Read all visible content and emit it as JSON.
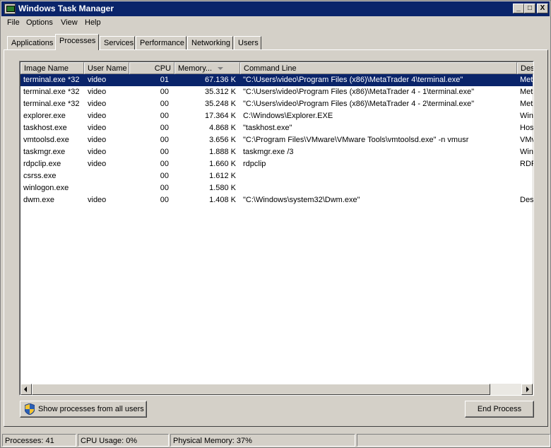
{
  "window": {
    "title": "Windows Task Manager",
    "minimize_label": "_",
    "maximize_label": "□",
    "close_label": "X"
  },
  "menu": {
    "items": [
      "File",
      "Options",
      "View",
      "Help"
    ]
  },
  "tabs": {
    "items": [
      "Applications",
      "Processes",
      "Services",
      "Performance",
      "Networking",
      "Users"
    ],
    "active": "Processes"
  },
  "table": {
    "columns": [
      "Image Name",
      "User Name",
      "CPU",
      "Memory...",
      "Command Line",
      "Des"
    ],
    "rows": [
      {
        "image": "terminal.exe *32",
        "user": "video",
        "cpu": "01",
        "memory": "67.136 K",
        "command": "\"C:\\Users\\video\\Program Files (x86)\\MetaTrader 4\\terminal.exe\"",
        "desc": "Met",
        "selected": true
      },
      {
        "image": "terminal.exe *32",
        "user": "video",
        "cpu": "00",
        "memory": "35.312 K",
        "command": "\"C:\\Users\\video\\Program Files (x86)\\MetaTrader 4 - 1\\terminal.exe\"",
        "desc": "Met"
      },
      {
        "image": "terminal.exe *32",
        "user": "video",
        "cpu": "00",
        "memory": "35.248 K",
        "command": "\"C:\\Users\\video\\Program Files (x86)\\MetaTrader 4 - 2\\terminal.exe\"",
        "desc": "Met"
      },
      {
        "image": "explorer.exe",
        "user": "video",
        "cpu": "00",
        "memory": "17.364 K",
        "command": "C:\\Windows\\Explorer.EXE",
        "desc": "Win"
      },
      {
        "image": "taskhost.exe",
        "user": "video",
        "cpu": "00",
        "memory": "4.868 K",
        "command": "\"taskhost.exe\"",
        "desc": "Hos"
      },
      {
        "image": "vmtoolsd.exe",
        "user": "video",
        "cpu": "00",
        "memory": "3.656 K",
        "command": "\"C:\\Program Files\\VMware\\VMware Tools\\vmtoolsd.exe\" -n vmusr",
        "desc": "VMv"
      },
      {
        "image": "taskmgr.exe",
        "user": "video",
        "cpu": "00",
        "memory": "1.888 K",
        "command": "taskmgr.exe /3",
        "desc": "Win"
      },
      {
        "image": "rdpclip.exe",
        "user": "video",
        "cpu": "00",
        "memory": "1.660 K",
        "command": "rdpclip",
        "desc": "RDF"
      },
      {
        "image": "csrss.exe",
        "user": "",
        "cpu": "00",
        "memory": "1.612 K",
        "command": "",
        "desc": ""
      },
      {
        "image": "winlogon.exe",
        "user": "",
        "cpu": "00",
        "memory": "1.580 K",
        "command": "",
        "desc": ""
      },
      {
        "image": "dwm.exe",
        "user": "video",
        "cpu": "00",
        "memory": "1.408 K",
        "command": "\"C:\\Windows\\system32\\Dwm.exe\"",
        "desc": "Des"
      }
    ]
  },
  "buttons": {
    "show_all": "Show processes from all users",
    "end_process": "End Process"
  },
  "status": {
    "processes": "Processes: 41",
    "cpu": "CPU Usage: 0%",
    "memory": "Physical Memory: 37%"
  },
  "colors": {
    "title_bar": "#0a246a",
    "selection": "#0a246a",
    "face": "#d4d0c8"
  }
}
